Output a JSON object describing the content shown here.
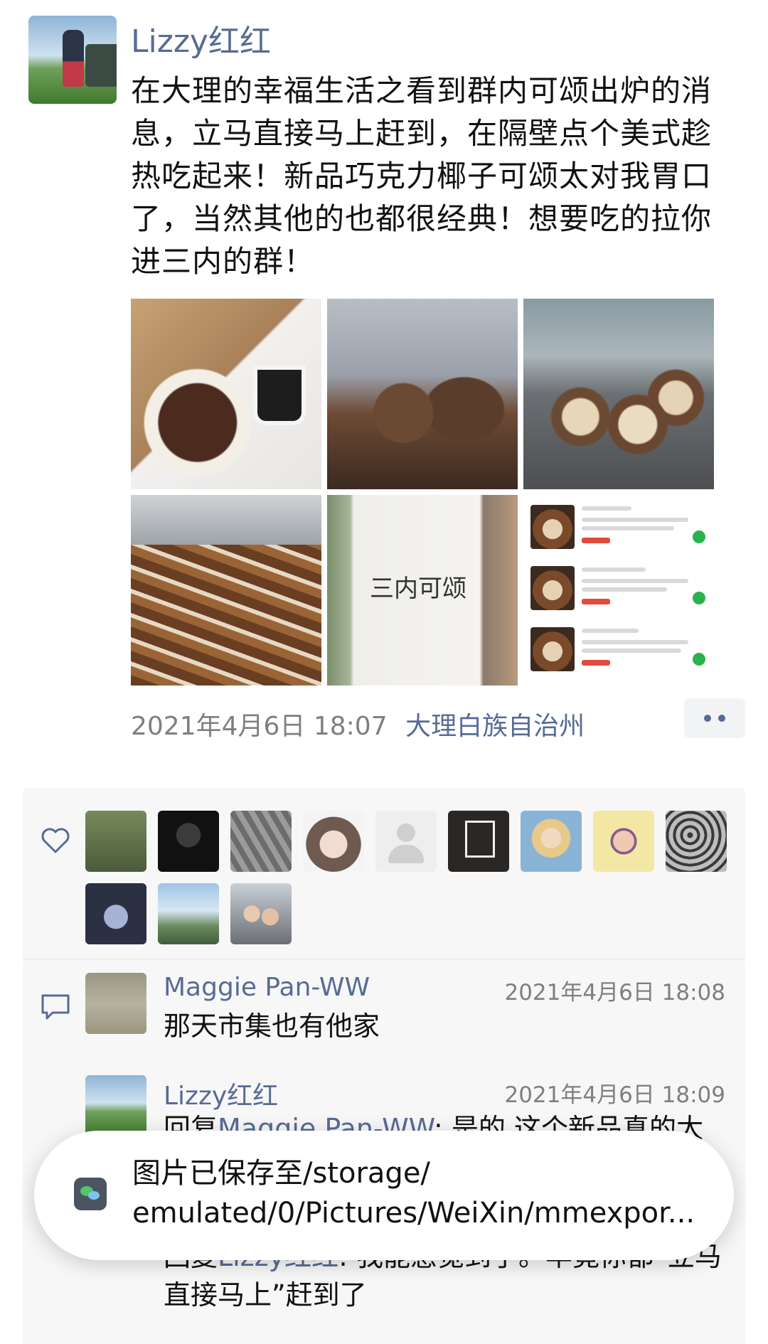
{
  "post": {
    "author": "Lizzy红红",
    "text": "在大理的幸福生活之看到群内可颂出炉的消息，立马直接马上赶到，在隔壁点个美式趁热吃起来！新品巧克力椰子可颂太对我胃口了，当然其他的也都很经典！想要吃的拉你进三内的群！",
    "photos": [
      {
        "icon": "croissant-coffee-photo"
      },
      {
        "icon": "croissant-tray-photo"
      },
      {
        "icon": "croissant-window-photo"
      },
      {
        "icon": "croissant-rows-photo"
      },
      {
        "icon": "bag-photo",
        "caption": "三内可颂"
      },
      {
        "icon": "menu-screenshot-photo"
      }
    ],
    "timestamp": "2021年4月6日 18:07",
    "location": "大理白族自治州"
  },
  "likes": {
    "icon": "heart-icon",
    "avatars_count": 12
  },
  "comments": [
    {
      "author": "Maggie Pan-WW",
      "time": "2021年4月6日 18:08",
      "text": "那天市集也有他家"
    },
    {
      "author": "Lizzy红红",
      "time": "2021年4月6日 18:09",
      "reply_prefix": "回复",
      "reply_to": "Maggie Pan-WW",
      "text": ": 是的,这个新品真的太"
    },
    {
      "reply_prefix": "回复",
      "reply_to": "Lizzy红红",
      "text": ": 我能感觉到了。毕竟你都“立马直接马上”赶到了"
    }
  ],
  "toast": {
    "line1": "图片已保存至/storage/",
    "line2": "emulated/0/Pictures/WeiXin/mmexpor..."
  },
  "colors": {
    "link": "#576b95",
    "panel": "#f7f7f7",
    "meta": "#7f7f7f"
  }
}
